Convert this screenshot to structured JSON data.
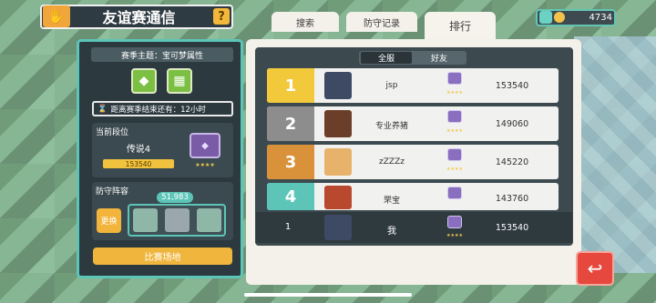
{
  "header": {
    "title": "友谊赛通信",
    "help_label": "?"
  },
  "currency": {
    "value": "4734"
  },
  "tabs": [
    {
      "label": "搜索"
    },
    {
      "label": "防守记录"
    },
    {
      "label": "排行"
    }
  ],
  "left": {
    "season_theme": "赛季主题：宝可梦属性",
    "countdown": "距离赛季结束还有：12小时",
    "current_rank_label": "当前段位",
    "rank_name": "传说4",
    "rank_points": "153540",
    "defense_label": "防守阵容",
    "swap_label": "更换",
    "team_power": "51,983",
    "arena_label": "比赛场地"
  },
  "ranking": {
    "filter_tabs": [
      "全服",
      "好友"
    ],
    "rows": [
      {
        "rank": "1",
        "name": "jsp",
        "score": "153540",
        "color": "#f3c93c"
      },
      {
        "rank": "2",
        "name": "专业养猪",
        "score": "149060",
        "color": "#8d8d8d"
      },
      {
        "rank": "3",
        "name": "zZZZz",
        "score": "145220",
        "color": "#d9923a"
      },
      {
        "rank": "4",
        "name": "罘宝",
        "score": "143760",
        "color": "#5cc5b8"
      }
    ],
    "self": {
      "rank": "1",
      "name": "我",
      "score": "153540"
    }
  },
  "icons": {
    "back": "back-arrow-icon",
    "gem": "rank-gem-icon"
  }
}
